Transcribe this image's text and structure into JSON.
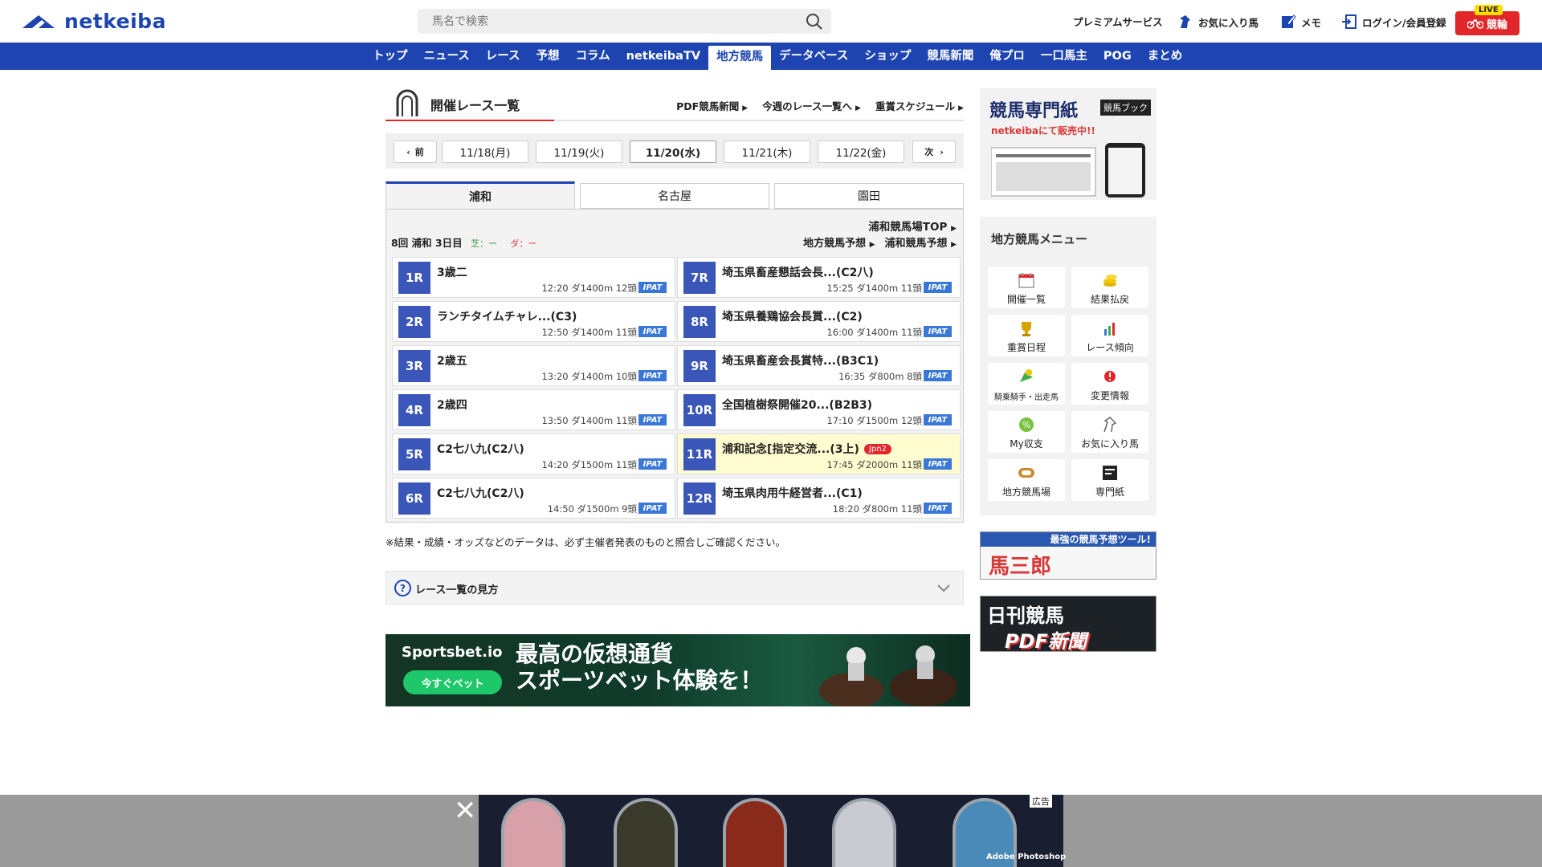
{
  "header": {
    "logo_text": "netkeiba",
    "search_placeholder": "馬名で検索",
    "premium": "プレミアムサービス",
    "favorite": "お気に入り馬",
    "memo": "メモ",
    "login": "ログイン/会員登録",
    "live_tag": "LIVE",
    "keirin": "競輪"
  },
  "nav": [
    "トップ",
    "ニュース",
    "レース",
    "予想",
    "コラム",
    "netkeibaTV",
    "地方競馬",
    "データベース",
    "ショップ",
    "競馬新聞",
    "俺プロ",
    "一口馬主",
    "POG",
    "まとめ"
  ],
  "page": {
    "title": "開催レース一覧",
    "links": [
      "PDF競馬新聞",
      "今週のレース一覧へ",
      "重賞スケジュール"
    ]
  },
  "dates": {
    "prev": "前",
    "next": "次",
    "items": [
      "11/18(月)",
      "11/19(火)",
      "11/20(水)",
      "11/21(木)",
      "11/22(金)"
    ],
    "active_index": 2
  },
  "tabs": [
    "浦和",
    "名古屋",
    "園田"
  ],
  "venue": {
    "top_link": "浦和競馬場TOP",
    "kaisai": "8回 浦和 3日目",
    "turf": "芝：ー",
    "dirt": "ダ：ー",
    "links": [
      "地方競馬予想",
      "浦和競馬予想"
    ]
  },
  "races": [
    {
      "no": "1R",
      "name": "3歳二",
      "info": "12:20 ダ1400m 12頭"
    },
    {
      "no": "2R",
      "name": "ランチタイムチャレ...(C3)",
      "info": "12:50 ダ1400m 11頭"
    },
    {
      "no": "3R",
      "name": "2歳五",
      "info": "13:20 ダ1400m 10頭"
    },
    {
      "no": "4R",
      "name": "2歳四",
      "info": "13:50 ダ1400m 11頭"
    },
    {
      "no": "5R",
      "name": "C2七八九(C2八)",
      "info": "14:20 ダ1500m 11頭"
    },
    {
      "no": "6R",
      "name": "C2七八九(C2八)",
      "info": "14:50 ダ1500m 9頭"
    },
    {
      "no": "7R",
      "name": "埼玉県畜産懇話会長...(C2八)",
      "info": "15:25 ダ1400m 11頭"
    },
    {
      "no": "8R",
      "name": "埼玉県養鶏協会長賞...(C2)",
      "info": "16:00 ダ1400m 11頭"
    },
    {
      "no": "9R",
      "name": "埼玉県畜産会長賞特...(B3C1)",
      "info": "16:35 ダ800m 8頭"
    },
    {
      "no": "10R",
      "name": "全国植樹祭開催20...(B2B3)",
      "info": "17:10 ダ1500m 12頭"
    },
    {
      "no": "11R",
      "name": "浦和記念[指定交流...(3上)",
      "info": "17:45 ダ2000m 11頭",
      "grade": "Jpn2"
    },
    {
      "no": "12R",
      "name": "埼玉県肉用牛経営者...(C1)",
      "info": "18:20 ダ800m 11頭"
    }
  ],
  "ipat": "IPAT",
  "notice": "※結果・成績・オッズなどのデータは、必ず主催者発表のものと照合しご確認ください。",
  "howto": "レース一覧の見方",
  "banner": {
    "brand": "Sportsbet.io",
    "cta": "今すぐベット",
    "line1": "最高の仮想通貨",
    "line2": "スポーツベット体験を！"
  },
  "sidebar": {
    "ad1_title": "競馬専門紙",
    "ad1_badge": "競馬ブック",
    "ad1_sub": "netkeibaにて販売中!!",
    "menu_title": "地方競馬メニュー",
    "menu": [
      "開催一覧",
      "結果払戻",
      "重賞日程",
      "レース傾向",
      "騎乗騎手・出走馬",
      "変更情報",
      "My収支",
      "お気に入り馬",
      "地方競馬場",
      "専門紙"
    ],
    "ad2_top": "最強の競馬予想ツール!",
    "ad2_big": "馬三郎",
    "ad3_a": "日刊競馬",
    "ad3_b": "PDF新聞"
  },
  "bottom_ad": {
    "label": "広告",
    "brand": "Adobe Photoshop"
  },
  "colors": {
    "brand_blue": "#1d44b1",
    "race_no_bg": "#3a56b8",
    "ipat": "#3a78d8",
    "live_red": "#e3262a",
    "highlight_row": "#fffcd0"
  }
}
